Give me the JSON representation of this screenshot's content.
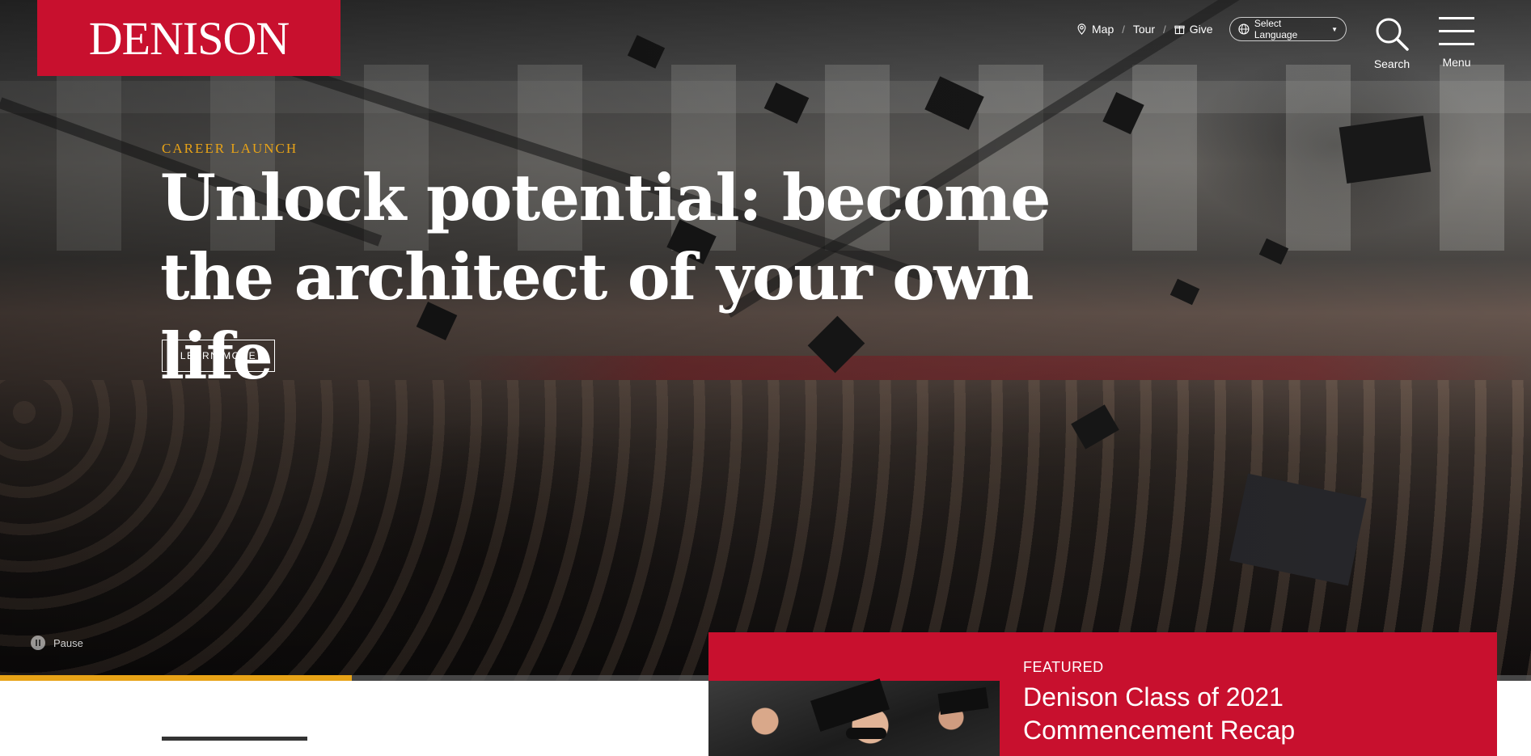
{
  "brand": {
    "logo_text": "DENISON",
    "accent": "#c8102e",
    "highlight": "#e8a317"
  },
  "utility_nav": {
    "map": {
      "label": "Map",
      "icon": "map-pin-icon"
    },
    "tour": {
      "label": "Tour"
    },
    "give": {
      "label": "Give",
      "icon": "gift-icon"
    },
    "language": {
      "label": "Select Language",
      "icon": "globe-icon"
    }
  },
  "header_actions": {
    "search": {
      "label": "Search",
      "icon": "search-icon"
    },
    "menu": {
      "label": "Menu",
      "icon": "hamburger-icon"
    }
  },
  "hero": {
    "eyebrow": "CAREER LAUNCH",
    "headline_line1": "Unlock potential: become",
    "headline_line2": "the architect of your own life",
    "cta_label": "LEARN MORE",
    "pause_label": "Pause",
    "progress_fraction": 0.23
  },
  "featured": {
    "label": "FEATURED",
    "title": "Denison Class of 2021 Commencement Recap"
  }
}
